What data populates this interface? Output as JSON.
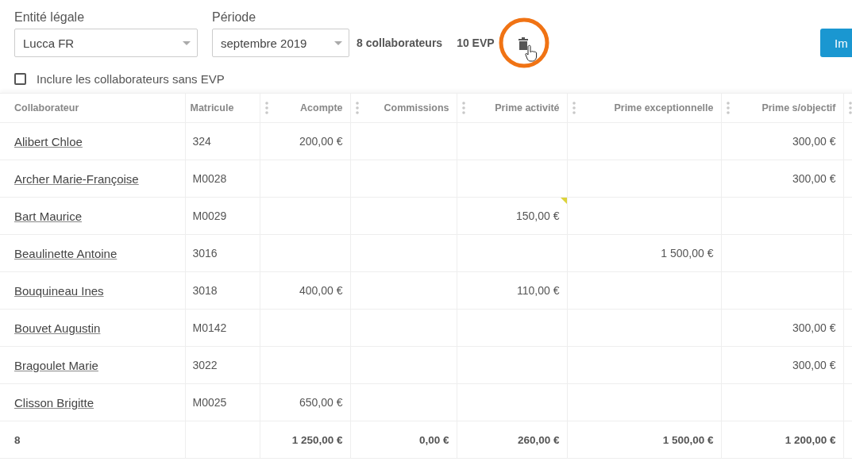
{
  "filters": {
    "entity": {
      "label": "Entité légale",
      "value": "Lucca FR"
    },
    "period": {
      "label": "Période",
      "value": "septembre 2019"
    },
    "employee_count": "8 collaborateurs",
    "evp_count": "10 EVP",
    "import_button": "Im",
    "include_checkbox": {
      "label": "Inclure les collaborateurs sans EVP",
      "checked": false
    }
  },
  "table": {
    "columns": [
      "Collaborateur",
      "Matricule",
      "Acompte",
      "Commissions",
      "Prime activité",
      "Prime exceptionnelle",
      "Prime s/objectif"
    ],
    "rows": [
      {
        "cells": [
          {
            "text": "Alibert Chloe",
            "note": false
          },
          {
            "text": "324",
            "note": false
          },
          {
            "text": "200,00 €",
            "note": false
          },
          {
            "text": "",
            "note": false
          },
          {
            "text": "",
            "note": false
          },
          {
            "text": "",
            "note": false
          },
          {
            "text": "300,00 €",
            "note": false
          }
        ]
      },
      {
        "cells": [
          {
            "text": "Archer Marie-Françoise",
            "note": false
          },
          {
            "text": "M0028",
            "note": false
          },
          {
            "text": "",
            "note": false
          },
          {
            "text": "",
            "note": false
          },
          {
            "text": "",
            "note": false
          },
          {
            "text": "",
            "note": false
          },
          {
            "text": "300,00 €",
            "note": false
          }
        ]
      },
      {
        "cells": [
          {
            "text": "Bart Maurice",
            "note": false
          },
          {
            "text": "M0029",
            "note": false
          },
          {
            "text": "",
            "note": false
          },
          {
            "text": "",
            "note": false
          },
          {
            "text": "150,00 €",
            "note": true
          },
          {
            "text": "",
            "note": false
          },
          {
            "text": "",
            "note": false
          }
        ]
      },
      {
        "cells": [
          {
            "text": "Beaulinette Antoine",
            "note": false
          },
          {
            "text": "3016",
            "note": false
          },
          {
            "text": "",
            "note": false
          },
          {
            "text": "",
            "note": false
          },
          {
            "text": "",
            "note": false
          },
          {
            "text": "1 500,00 €",
            "note": false
          },
          {
            "text": "",
            "note": false
          }
        ]
      },
      {
        "cells": [
          {
            "text": "Bouquineau Ines",
            "note": false
          },
          {
            "text": "3018",
            "note": false
          },
          {
            "text": "400,00 €",
            "note": false
          },
          {
            "text": "",
            "note": false
          },
          {
            "text": "110,00 €",
            "note": false
          },
          {
            "text": "",
            "note": false
          },
          {
            "text": "",
            "note": false
          }
        ]
      },
      {
        "cells": [
          {
            "text": "Bouvet Augustin",
            "note": false
          },
          {
            "text": "M0142",
            "note": false
          },
          {
            "text": "",
            "note": false
          },
          {
            "text": "",
            "note": false
          },
          {
            "text": "",
            "note": false
          },
          {
            "text": "",
            "note": false
          },
          {
            "text": "300,00 €",
            "note": false
          }
        ]
      },
      {
        "cells": [
          {
            "text": "Bragoulet Marie",
            "note": false
          },
          {
            "text": "3022",
            "note": false
          },
          {
            "text": "",
            "note": false
          },
          {
            "text": "",
            "note": false
          },
          {
            "text": "",
            "note": false
          },
          {
            "text": "",
            "note": false
          },
          {
            "text": "300,00 €",
            "note": false
          }
        ]
      },
      {
        "cells": [
          {
            "text": "Clisson Brigitte",
            "note": false
          },
          {
            "text": "M0025",
            "note": false
          },
          {
            "text": "650,00 €",
            "note": false
          },
          {
            "text": "",
            "note": false
          },
          {
            "text": "",
            "note": false
          },
          {
            "text": "",
            "note": false
          },
          {
            "text": "",
            "note": false
          }
        ]
      },
      {
        "cells": [
          {
            "text": "8",
            "note": false
          },
          {
            "text": "",
            "note": false
          },
          {
            "text": "1 250,00 €",
            "note": false
          },
          {
            "text": "0,00 €",
            "note": false
          },
          {
            "text": "260,00 €",
            "note": false
          },
          {
            "text": "1 500,00 €",
            "note": false
          },
          {
            "text": "1 200,00 €",
            "note": false
          }
        ]
      }
    ]
  }
}
